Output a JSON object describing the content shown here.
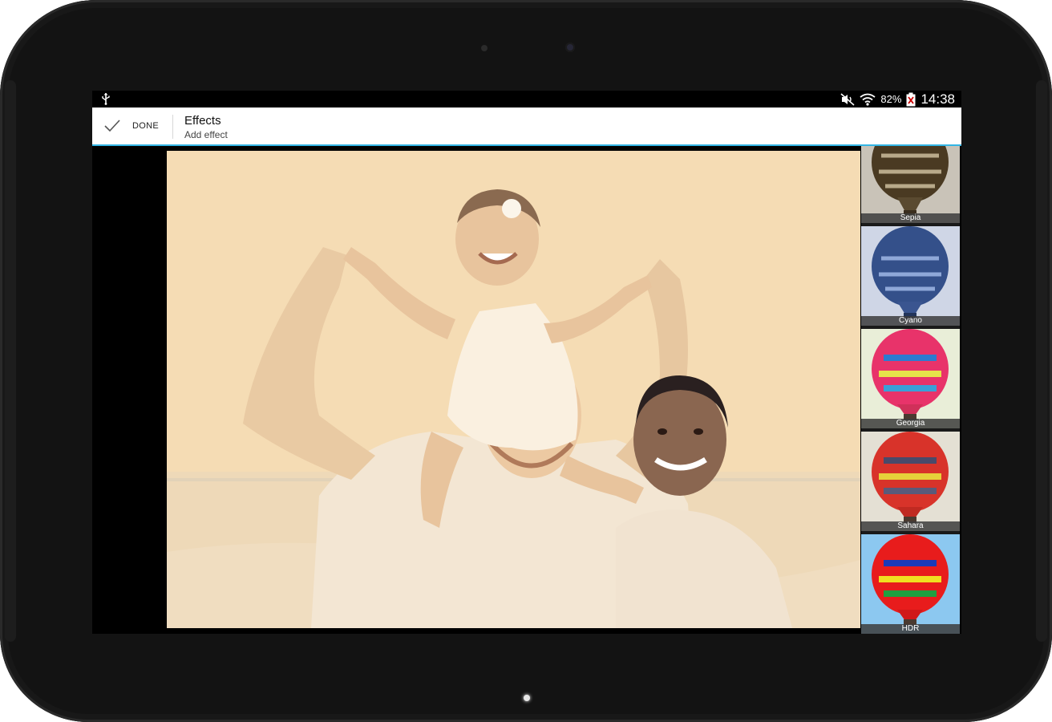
{
  "status_bar": {
    "battery": "82%",
    "time": "14:38",
    "icons": [
      "usb-icon",
      "mute-icon",
      "wifi-icon",
      "battery-icon"
    ]
  },
  "action_bar": {
    "done_label": "DONE",
    "title": "Effects",
    "subtitle": "Add effect"
  },
  "accent_color": "#33b5e5",
  "effects": [
    {
      "name": "Sepia"
    },
    {
      "name": "Cyano"
    },
    {
      "name": "Georgia"
    },
    {
      "name": "Sahara"
    },
    {
      "name": "HDR"
    }
  ]
}
